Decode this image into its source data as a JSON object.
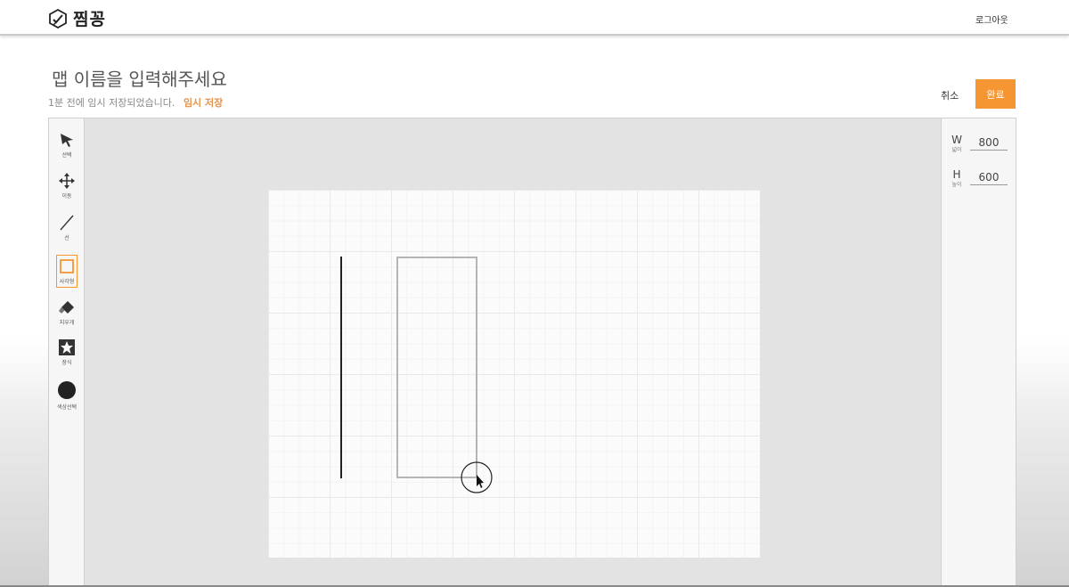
{
  "header": {
    "logo_text": "찜꽁",
    "logout_label": "로그아웃"
  },
  "editor_header": {
    "title": "맵 이름을 입력해주세요",
    "autosave_status": "1분 전에 임시 저장되었습니다.",
    "temp_save_label": "임시 저장",
    "cancel_label": "취소",
    "done_label": "완료"
  },
  "toolbar": {
    "tools": [
      {
        "id": "select",
        "label": "선택",
        "icon": "cursor-arrow-icon"
      },
      {
        "id": "move",
        "label": "이동",
        "icon": "move-arrows-icon"
      },
      {
        "id": "line",
        "label": "선",
        "icon": "line-icon"
      },
      {
        "id": "rect",
        "label": "사각형",
        "icon": "square-icon",
        "active": true
      },
      {
        "id": "eraser",
        "label": "지우개",
        "icon": "eraser-icon"
      },
      {
        "id": "decoration",
        "label": "장식",
        "icon": "star-icon"
      },
      {
        "id": "color",
        "label": "색상선택",
        "icon": "color-circle-icon"
      }
    ]
  },
  "properties": {
    "width": {
      "letter": "W",
      "label": "넓이",
      "value": "800"
    },
    "height": {
      "letter": "H",
      "label": "높이",
      "value": "600"
    }
  },
  "colors": {
    "accent": "#f59633",
    "temp_save": "#e8934a",
    "canvas_bg": "#fbfbfb",
    "workspace_bg": "#e3e3e4"
  }
}
